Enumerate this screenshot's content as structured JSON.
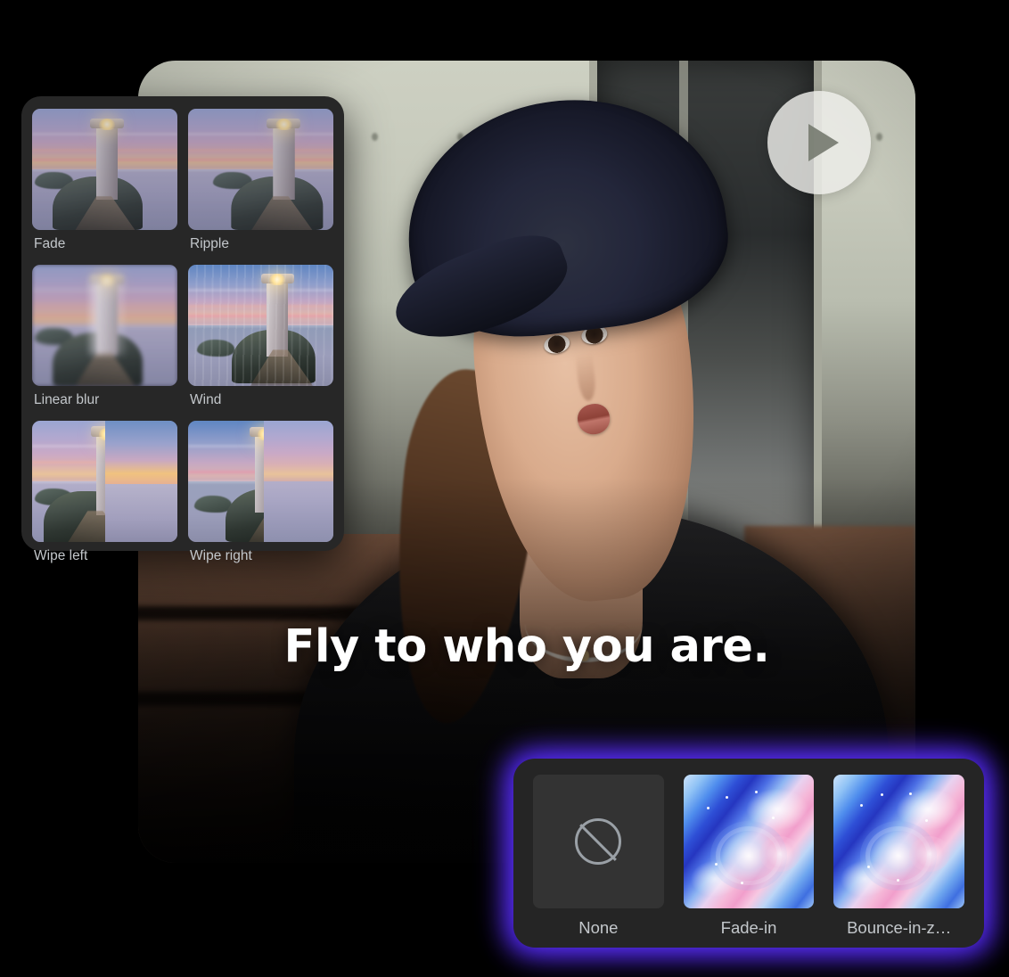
{
  "app": {
    "background_color": "#000000",
    "accent_glow_color": "#4b22f5",
    "panel_bg_color": "#272727",
    "label_color": "#c3c7cb"
  },
  "video_card": {
    "caption_text": "Fly to who you are.",
    "play_button_label": "Play",
    "play_icon": "play-triangle-icon"
  },
  "transitions_panel": {
    "items": [
      {
        "label": "Fade",
        "thumb_style": "fade"
      },
      {
        "label": "Ripple",
        "thumb_style": "ripple"
      },
      {
        "label": "Linear blur",
        "thumb_style": "linear-blur"
      },
      {
        "label": "Wind",
        "thumb_style": "wind"
      },
      {
        "label": "Wipe left",
        "thumb_style": "wipe-left"
      },
      {
        "label": "Wipe right",
        "thumb_style": "wipe-right"
      }
    ]
  },
  "animations_panel": {
    "items": [
      {
        "label": "None",
        "thumb_style": "none",
        "icon": "prohibition-icon"
      },
      {
        "label": "Fade-in",
        "thumb_style": "marble"
      },
      {
        "label": "Bounce-in-z…",
        "thumb_style": "marble"
      }
    ]
  }
}
